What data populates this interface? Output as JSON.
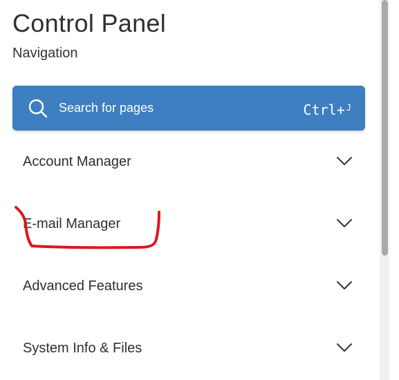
{
  "header": {
    "title": "Control Panel",
    "subtitle": "Navigation"
  },
  "search": {
    "placeholder": "Search for pages",
    "shortcut_main": "Ctrl+",
    "shortcut_key": "J",
    "background_color": "#3d7fc0",
    "icon": "search-icon"
  },
  "nav": {
    "items": [
      {
        "label": "Account Manager",
        "icon": "chevron-down-icon"
      },
      {
        "label": "E-mail Manager",
        "icon": "chevron-down-icon"
      },
      {
        "label": "Advanced Features",
        "icon": "chevron-down-icon"
      },
      {
        "label": "System Info & Files",
        "icon": "chevron-down-icon"
      }
    ]
  },
  "annotation": {
    "color": "#e0151b",
    "target": "E-mail Manager"
  }
}
